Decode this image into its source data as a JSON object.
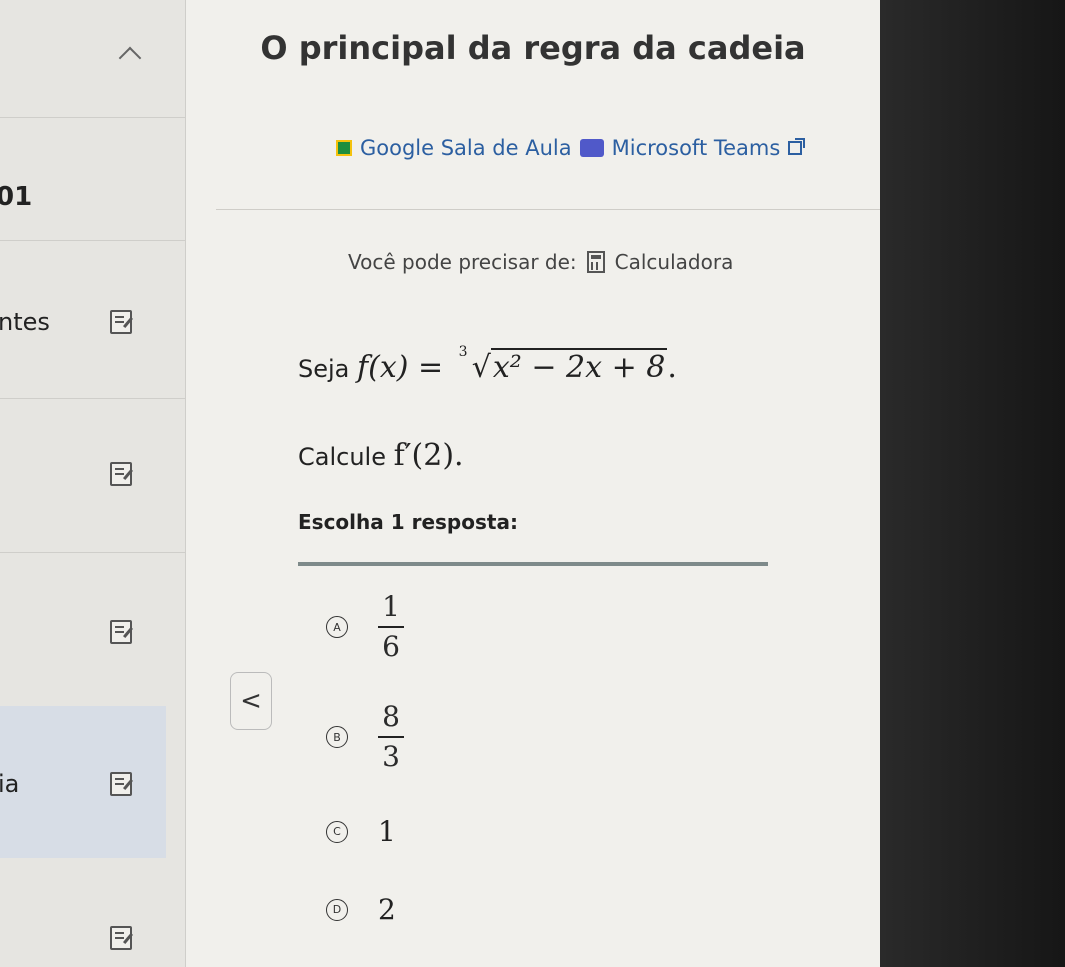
{
  "sidebar": {
    "unit_number": "01",
    "items": [
      {
        "label": "ntes"
      },
      {
        "label": ""
      },
      {
        "label": ""
      },
      {
        "label": "ia"
      },
      {
        "label": ""
      }
    ]
  },
  "header": {
    "title": "O principal da regra da cadeia"
  },
  "links": {
    "google_classroom": "Google Sala de Aula",
    "microsoft_teams": "Microsoft Teams"
  },
  "tools": {
    "prefix": "Você pode precisar de:",
    "calculator": "Calculadora"
  },
  "question": {
    "let_word": "Seja",
    "function_lhs": "f(x) =",
    "root_index": "3",
    "radicand": "x² − 2x + 8",
    "end": ".",
    "compute_word": "Calcule",
    "compute_expr": "f′(2)."
  },
  "choices": {
    "prompt": "Escolha 1 resposta:",
    "options": [
      {
        "letter": "A",
        "numerator": "1",
        "denominator": "6"
      },
      {
        "letter": "B",
        "numerator": "8",
        "denominator": "3"
      },
      {
        "letter": "C",
        "value": "1"
      },
      {
        "letter": "D",
        "value": "2"
      }
    ]
  },
  "nav": {
    "back_symbol": "<"
  }
}
